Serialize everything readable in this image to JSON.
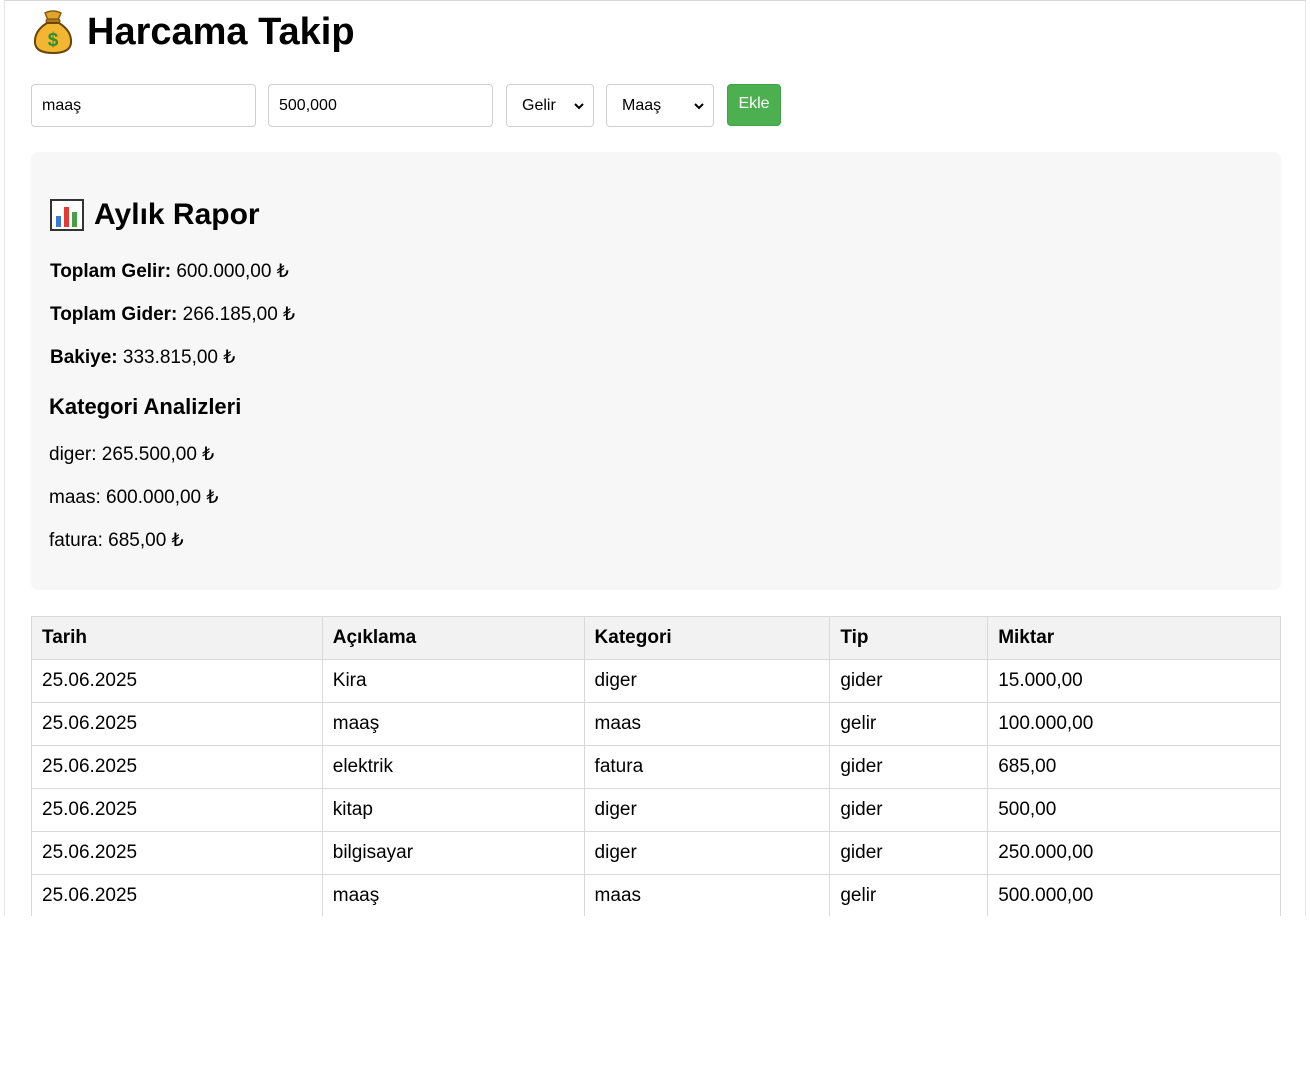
{
  "header": {
    "title": "Harcama Takip",
    "icon": "money-bag-icon"
  },
  "form": {
    "description_value": "maaş",
    "amount_value": "500,000",
    "type_selected": "Gelir",
    "category_selected": "Maaş",
    "add_label": "Ekle",
    "add_color": "#4caf50"
  },
  "report": {
    "icon": "bar-chart-icon",
    "title": "Aylık Rapor",
    "income_label": "Toplam Gelir:",
    "income_value": "600.000,00 ₺",
    "expense_label": "Toplam Gider:",
    "expense_value": "266.185,00 ₺",
    "balance_label": "Bakiye:",
    "balance_value": "333.815,00 ₺",
    "categories_title": "Kategori Analizleri",
    "categories": [
      "diger: 265.500,00 ₺",
      "maas: 600.000,00 ₺",
      "fatura: 685,00 ₺"
    ]
  },
  "table": {
    "headers": [
      "Tarih",
      "Açıklama",
      "Kategori",
      "Tip",
      "Miktar"
    ],
    "rows": [
      [
        "25.06.2025",
        "Kira",
        "diger",
        "gider",
        "15.000,00"
      ],
      [
        "25.06.2025",
        "maaş",
        "maas",
        "gelir",
        "100.000,00"
      ],
      [
        "25.06.2025",
        "elektrik",
        "fatura",
        "gider",
        "685,00"
      ],
      [
        "25.06.2025",
        "kitap",
        "diger",
        "gider",
        "500,00"
      ],
      [
        "25.06.2025",
        "bilgisayar",
        "diger",
        "gider",
        "250.000,00"
      ],
      [
        "25.06.2025",
        "maaş",
        "maas",
        "gelir",
        "500.000,00"
      ]
    ]
  }
}
